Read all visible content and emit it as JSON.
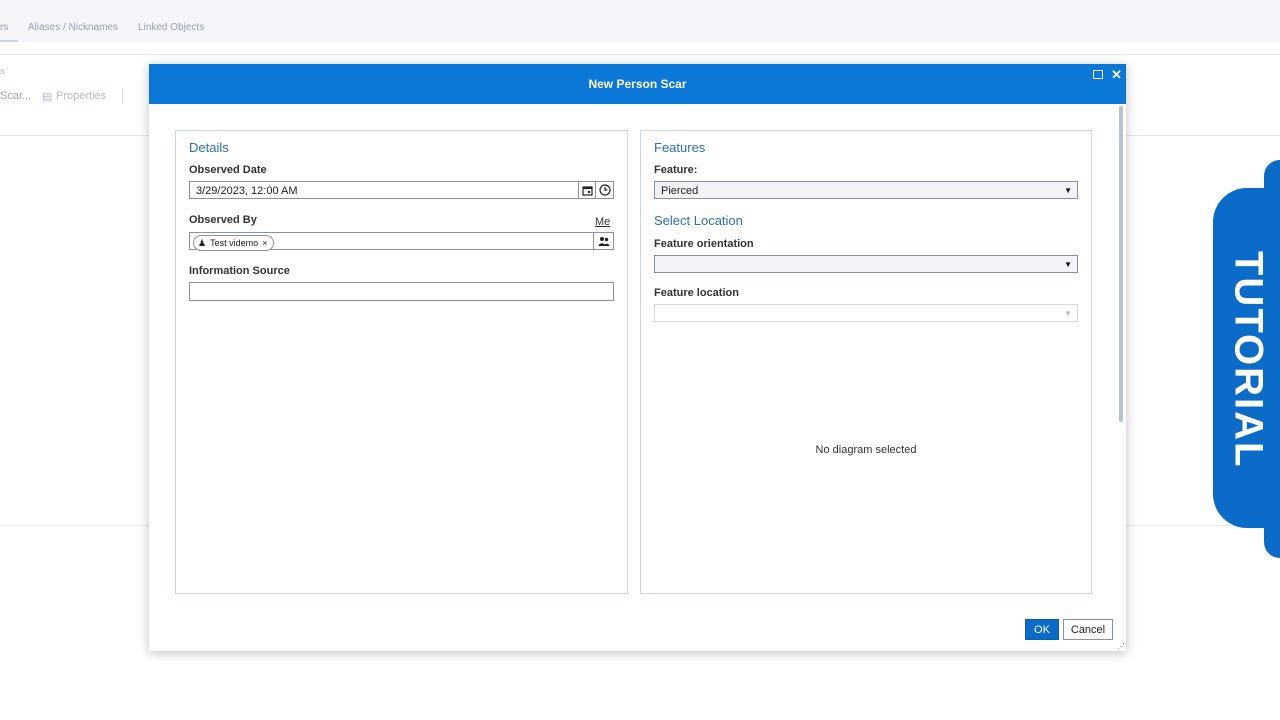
{
  "background": {
    "tabs": [
      "rs",
      "Aliases / Nicknames",
      "Linked Objects"
    ],
    "toolbar_small": "s",
    "toolbar_scar": "Scar...",
    "toolbar_properties": "Properties"
  },
  "tutorial": {
    "label": "TUTORIAL"
  },
  "dialog": {
    "title": "New Person Scar",
    "details": {
      "title": "Details",
      "observed_date_label": "Observed Date",
      "observed_date_value": "3/29/2023, 12:00 AM",
      "observed_by_label": "Observed By",
      "me_link": "Me",
      "observed_by_chip": "Test videmo",
      "information_source_label": "Information Source",
      "information_source_value": ""
    },
    "features": {
      "title": "Features",
      "feature_label": "Feature:",
      "feature_value": "Pierced",
      "select_location_title": "Select Location",
      "orientation_label": "Feature orientation",
      "orientation_value": "",
      "location_label": "Feature location",
      "location_value": "",
      "no_diagram": "No diagram selected"
    },
    "ok_label": "OK",
    "cancel_label": "Cancel"
  },
  "colors": {
    "header": "#0b77d6",
    "accent": "#0b6bc9",
    "section_title": "#2c6fb5"
  }
}
